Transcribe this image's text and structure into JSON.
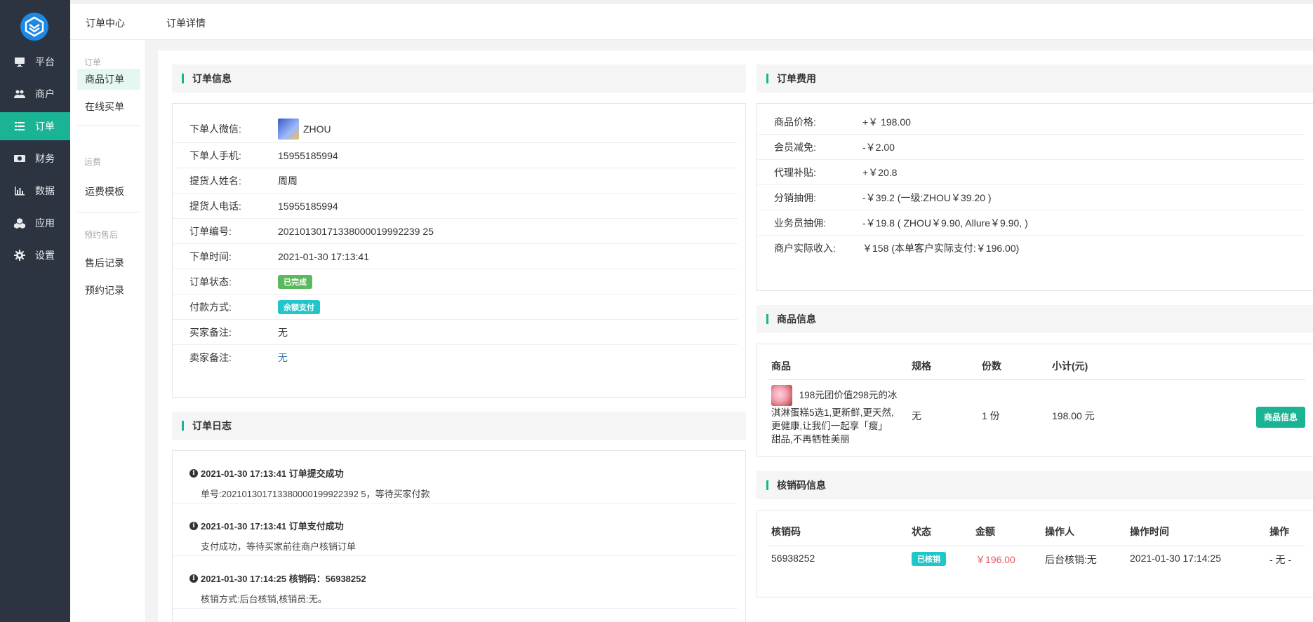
{
  "nav": {
    "items": [
      {
        "label": "平台",
        "icon": "monitor-icon"
      },
      {
        "label": "商户",
        "icon": "users-icon"
      },
      {
        "label": "订单",
        "icon": "list-icon"
      },
      {
        "label": "财务",
        "icon": "money-icon"
      },
      {
        "label": "数据",
        "icon": "bar-chart-icon"
      },
      {
        "label": "应用",
        "icon": "cubes-icon"
      },
      {
        "label": "设置",
        "icon": "gear-icon"
      }
    ],
    "active": "订单"
  },
  "topbar": {
    "tab1": "订单中心",
    "tab2": "订单详情"
  },
  "subnav": {
    "group1": "订单",
    "item1": "商品订单",
    "item2": "在线买单",
    "group2": "运费",
    "item3": "运费模板",
    "group3": "预约售后",
    "item4": "售后记录",
    "item5": "预约记录"
  },
  "order_info": {
    "title": "订单信息",
    "rows": [
      {
        "k": "下单人微信:",
        "v": "ZHOU"
      },
      {
        "k": "下单人手机:",
        "v": "15955185994"
      },
      {
        "k": "提货人姓名:",
        "v": "周周"
      },
      {
        "k": "提货人电话:",
        "v": "15955185994"
      },
      {
        "k": "订单编号:",
        "v": "20210130171338000019992239 25"
      },
      {
        "k": "下单时间:",
        "v": "2021-01-30 17:13:41"
      },
      {
        "k": "订单状态:",
        "v": "已完成"
      },
      {
        "k": "付款方式:",
        "v": "余额支付"
      },
      {
        "k": "买家备注:",
        "v": "无"
      },
      {
        "k": "卖家备注:",
        "v": "无"
      }
    ],
    "status_color": "#5cb85c",
    "pay_color": "#23c6c8"
  },
  "order_log": {
    "title": "订单日志",
    "items": [
      {
        "title": "2021-01-30 17:13:41 订单提交成功",
        "desc": "单号:202101301713380000199922392 5，等待买家付款"
      },
      {
        "title": "2021-01-30 17:13:41 订单支付成功",
        "desc": "支付成功，等待买家前往商户核销订单"
      },
      {
        "title": "2021-01-30 17:14:25 核销码：56938252",
        "desc": "核销方式:后台核销,核销员:无。"
      }
    ]
  },
  "fees": {
    "title": "订单费用",
    "rows": [
      {
        "k": "商品价格:",
        "v": "+￥ 198.00"
      },
      {
        "k": "会员减免:",
        "v": "-￥2.00"
      },
      {
        "k": "代理补贴:",
        "v": "+￥20.8"
      },
      {
        "k": "分销抽佣:",
        "v": "-￥39.2 (一级:ZHOU￥39.20 )"
      },
      {
        "k": "业务员抽佣:",
        "v": "-￥19.8 ( ZHOU￥9.90, Allure￥9.90, )"
      },
      {
        "k": "商户实际收入:",
        "v": "￥158 (本单客户实际支付:￥196.00)"
      }
    ]
  },
  "goods": {
    "title": "商品信息",
    "headers": [
      "商品",
      "规格",
      "份数",
      "小计(元)"
    ],
    "name_line1": "198元团价值298元的冰",
    "name_line2": "淇淋蛋糕5选1,更新鲜,更天然,",
    "name_line3": "更健康,让我们一起享「瘦」",
    "name_line4": "甜品,不再牺牲美丽",
    "spec": "无",
    "qty": "1 份",
    "subtotal": "198.00 元",
    "button": "商品信息"
  },
  "verify": {
    "title": "核销码信息",
    "headers": [
      "核销码",
      "状态",
      "金额",
      "操作人",
      "操作时间",
      "操作"
    ],
    "code": "56938252",
    "status": "已核销",
    "amount": "￥196.00",
    "operator": "后台核销:无",
    "time": "2021-01-30 17:14:25",
    "action": "- 无 -",
    "amount_color": "#ed5565"
  }
}
